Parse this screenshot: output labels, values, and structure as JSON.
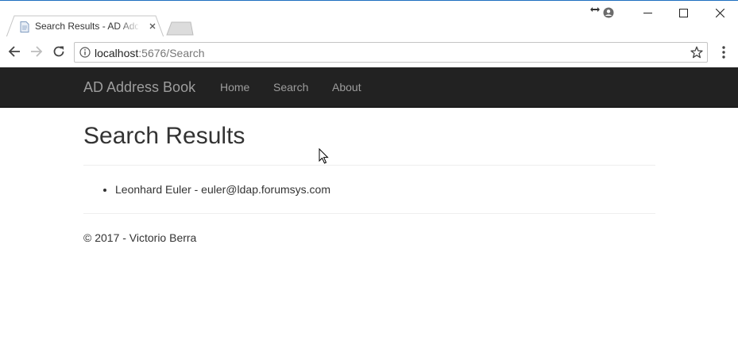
{
  "browser": {
    "tab_title": "Search Results - AD Address Book",
    "url_host": "localhost",
    "url_rest": ":5676/Search"
  },
  "site": {
    "brand": "AD Address Book",
    "nav": [
      "Home",
      "Search",
      "About"
    ]
  },
  "page": {
    "heading": "Search Results",
    "results": [
      "Leonhard Euler - euler@ldap.forumsys.com"
    ],
    "footer": "© 2017 - Victorio Berra"
  },
  "colors": {
    "navbar_bg": "#222222",
    "nav_text": "#9d9d9d",
    "body_text": "#333333",
    "window_accent": "#1e6fbf"
  },
  "icons": [
    "page-favicon-icon",
    "tab-close-icon",
    "new-tab-icon",
    "resize-arrows-icon",
    "profile-icon",
    "minimize-icon",
    "maximize-icon",
    "close-window-icon",
    "back-arrow-icon",
    "forward-arrow-icon",
    "reload-icon",
    "info-icon",
    "star-icon",
    "kebab-menu-icon",
    "mouse-pointer-icon"
  ]
}
